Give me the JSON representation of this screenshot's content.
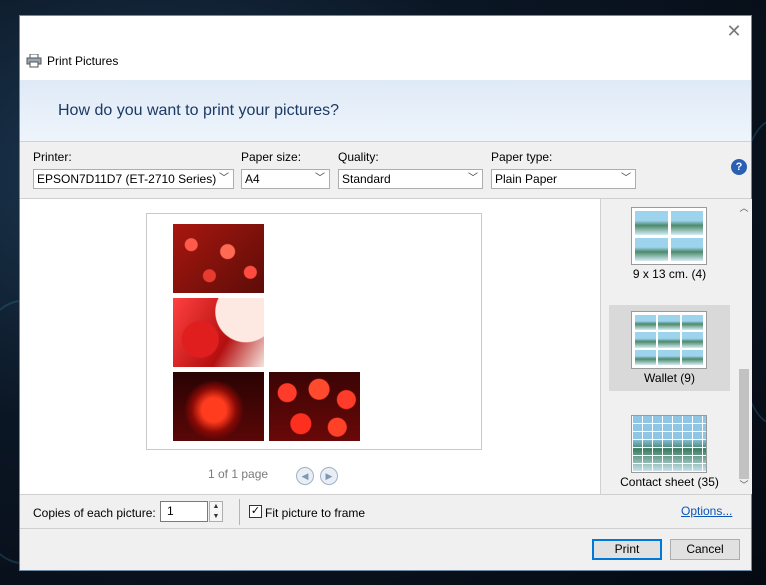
{
  "window": {
    "title": "Print Pictures",
    "heading": "How do you want to print your pictures?"
  },
  "settings": {
    "printer_label": "Printer:",
    "printer_value": "EPSON7D11D7 (ET-2710 Series)",
    "paper_size_label": "Paper size:",
    "paper_size_value": "A4",
    "quality_label": "Quality:",
    "quality_value": "Standard",
    "paper_type_label": "Paper type:",
    "paper_type_value": "Plain Paper"
  },
  "preview": {
    "pager_text": "1 of 1 page",
    "photos": [
      {
        "name": "red-flowers-photo",
        "color": "#c0201c"
      },
      {
        "name": "red-maple-photo",
        "color": "#e23a3a"
      },
      {
        "name": "red-lantern-photo",
        "color": "#7a0e0e"
      },
      {
        "name": "red-lanterns-group-photo",
        "color": "#b01212"
      }
    ]
  },
  "layouts": [
    {
      "label": "9 x 13 cm. (4)",
      "selected": false
    },
    {
      "label": "Wallet (9)",
      "selected": true
    },
    {
      "label": "Contact sheet (35)",
      "selected": false
    }
  ],
  "options": {
    "copies_label": "Copies of each picture:",
    "copies_value": "1",
    "fit_label": "Fit picture to frame",
    "fit_checked": true,
    "options_link": "Options..."
  },
  "footer": {
    "print_label": "Print",
    "cancel_label": "Cancel"
  }
}
